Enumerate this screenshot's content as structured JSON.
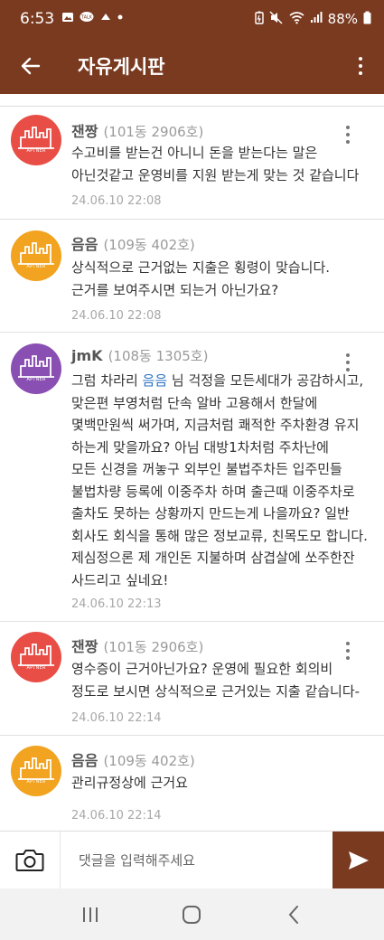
{
  "status_bar": {
    "time": "6:53",
    "battery": "88%"
  },
  "app_bar": {
    "title": "자유게시판"
  },
  "colors": {
    "brand": "#7a3a20",
    "mention": "#2a72c2",
    "avatar_red": "#e94e46",
    "avatar_orange": "#f2a31f",
    "avatar_purple": "#8a4fb3"
  },
  "comments": [
    {
      "author": "잰짱",
      "unit": "(101동 2906호)",
      "avatar_label": "APTNER",
      "lines": [
        "수고비를 받는건 아니니 돈을 받는다는 말은",
        "아닌것같고 운영비를 지원 받는게 맞는 것 같습니다"
      ],
      "date": "24.06.10 22:08"
    },
    {
      "author": "음음",
      "unit": "(109동 402호)",
      "avatar_label": "APTNER",
      "lines": [
        "상식적으로 근거없는 지출은 횡령이 맞습니다.",
        "근거를 보여주시면 되는거 아닌가요?"
      ],
      "date": "24.06.10 22:08"
    },
    {
      "author": "jmK",
      "unit": "(108동 1305호)",
      "avatar_label": "APTNER",
      "mention": "음음",
      "first_line_before": "그럼 차라리 ",
      "first_line_after": " 님 걱정을 모든세대가 공감하시고,",
      "lines": [
        "맞은편 부영처럼 단속 알바 고용해서 한달에",
        "몇백만원씩 써가며, 지금처럼 쾌적한 주차환경 유지",
        "하는게 맞을까요? 아님 대방1차처럼 주차난에",
        "모든 신경을 꺼놓구 외부인 불법주차든  입주민들",
        "불법차량 등록에 이중주차 하며 출근때 이중주차로",
        "출차도 못하는 상황까지 만드는게 나을까요? 일반",
        "회사도 회식을 통해 많은 정보교류, 친목도모 합니다.",
        "제심정으론 제 개인돈 지불하며 삼겹살에 쏘주한잔",
        "사드리고 싶네요!"
      ],
      "date": "24.06.10 22:13"
    },
    {
      "author": "잰짱",
      "unit": "(101동 2906호)",
      "avatar_label": "APTNER",
      "lines": [
        "영수증이 근거아닌가요? 운영에 필요한 회의비",
        "정도로 보시면 상식적으로 근거있는 지출 같습니다-"
      ],
      "date": "24.06.10 22:14"
    },
    {
      "author": "음음",
      "unit": "(109동 402호)",
      "avatar_label": "APTNER",
      "lines": [
        "관리규정상에 근거요"
      ],
      "date": "24.06.10 22:14"
    }
  ],
  "input_bar": {
    "placeholder": "댓글을 입력해주세요"
  }
}
